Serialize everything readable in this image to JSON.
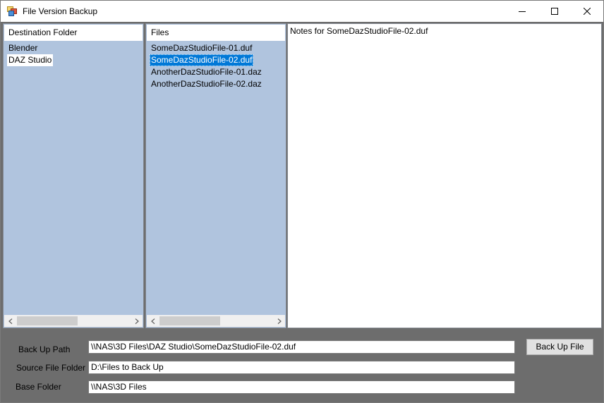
{
  "window": {
    "title": "File Version Backup",
    "icon": "app-icon",
    "controls": {
      "minimize_icon": "minimize-icon",
      "maximize_icon": "maximize-icon",
      "close_icon": "close-icon"
    }
  },
  "destination_list": {
    "header": "Destination Folder",
    "items": [
      "Blender",
      "DAZ Studio"
    ],
    "selected": "DAZ Studio"
  },
  "files_list": {
    "header": "Files",
    "items": [
      "SomeDazStudioFile-01.duf",
      "SomeDazStudioFile-02.duf",
      "AnotherDazStudioFile-01.daz",
      "AnotherDazStudioFile-02.daz"
    ],
    "selected": "SomeDazStudioFile-02.duf"
  },
  "notes": {
    "text": "Notes for SomeDazStudioFile-02.duf"
  },
  "form": {
    "backup_path_label": "Back Up Path",
    "backup_path_value": "\\\\NAS\\3D Files\\DAZ Studio\\SomeDazStudioFile-02.duf",
    "source_folder_label": "Source File Folder",
    "source_folder_value": "D:\\Files to Back Up",
    "base_folder_label": "Base Folder",
    "base_folder_value": "\\\\NAS\\3D Files",
    "backup_button_label": "Back Up File"
  },
  "colors": {
    "list_background": "#b0c4de",
    "client_background": "#6d6d6d",
    "selection_highlight": "#0078d7",
    "button_face": "#e1e1e1"
  }
}
